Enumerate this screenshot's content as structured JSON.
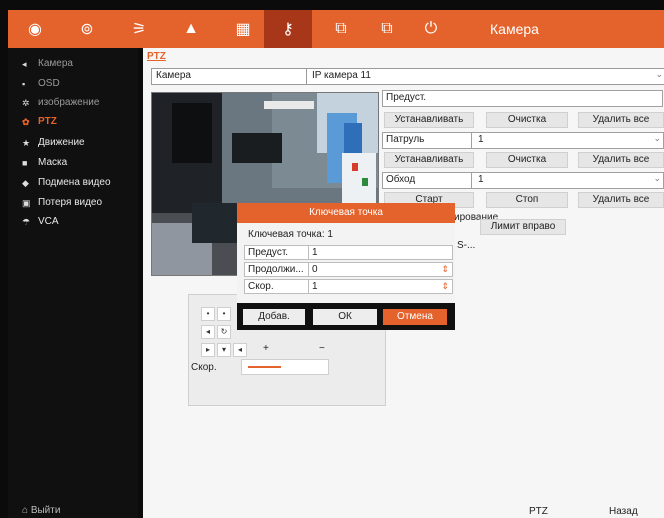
{
  "topbar": {
    "title": "Камера",
    "icons": [
      {
        "name": "live-view-icon",
        "glyph": "◉"
      },
      {
        "name": "playback-icon",
        "glyph": "⊚"
      },
      {
        "name": "record-icon",
        "glyph": "⚞"
      },
      {
        "name": "alarm-icon",
        "glyph": "▲"
      },
      {
        "name": "storage-icon",
        "glyph": "▦"
      },
      {
        "name": "camera-settings-icon",
        "glyph": "⚷"
      },
      {
        "name": "network-icon",
        "glyph": "⧉"
      },
      {
        "name": "maintenance-icon",
        "glyph": "⧉"
      },
      {
        "name": "power-icon",
        "glyph": "⏻"
      }
    ],
    "active_index": 5
  },
  "sidebar": {
    "items": [
      {
        "label": "Камера",
        "icon": "camera-icon"
      },
      {
        "label": "OSD",
        "icon": "osd-icon"
      },
      {
        "label": "изображение",
        "icon": "image-icon"
      },
      {
        "label": "PTZ",
        "icon": "ptz-icon"
      },
      {
        "label": "Движение",
        "icon": "motion-icon"
      },
      {
        "label": "Маска",
        "icon": "mask-icon"
      },
      {
        "label": "Подмена видео",
        "icon": "tamper-icon"
      },
      {
        "label": "Потеря видео",
        "icon": "video-loss-icon"
      },
      {
        "label": "VCA",
        "icon": "vca-icon"
      }
    ],
    "active_index": 3,
    "exit_label": "Выйти"
  },
  "main": {
    "tab_label": "PTZ",
    "camera_label": "Камера",
    "camera_value": "IP камера 11",
    "preset": {
      "label": "Предуст.",
      "value": "",
      "buttons": [
        "Устанавливать",
        "Очистка",
        "Удалить все"
      ]
    },
    "patrol": {
      "label": "Патруль",
      "value": "1",
      "buttons": [
        "Устанавливать",
        "Очистка",
        "Удалить все"
      ]
    },
    "pattern": {
      "label": "Обход",
      "value": "1",
      "buttons": [
        "Старт",
        "Стоп",
        "Удалить все"
      ]
    },
    "scan_fragment": "ирование",
    "scan_buttons": [
      "Лимит вправо"
    ],
    "scan_fragment2": "S-...",
    "controls": {
      "speed_label": "Скор.",
      "zoom_plus": "+",
      "zoom_minus": "−",
      "speed_level": 0.45
    }
  },
  "dialog": {
    "title": "Ключевая точка",
    "keypoint_label": "Ключевая точка: 1",
    "rows": [
      {
        "label": "Предуст.",
        "value": "1",
        "spin": false
      },
      {
        "label": "Продолжи...",
        "value": "0",
        "spin": true
      },
      {
        "label": "Скор.",
        "value": "1",
        "spin": true
      }
    ],
    "buttons": {
      "add": "Добав.",
      "ok": "ОК",
      "cancel": "Отмена"
    }
  },
  "statusbar": {
    "ptz_label": "PTZ",
    "back_label": "Назад"
  },
  "colors": {
    "accent": "#e4622c",
    "active_topbar": "#a8371a"
  }
}
